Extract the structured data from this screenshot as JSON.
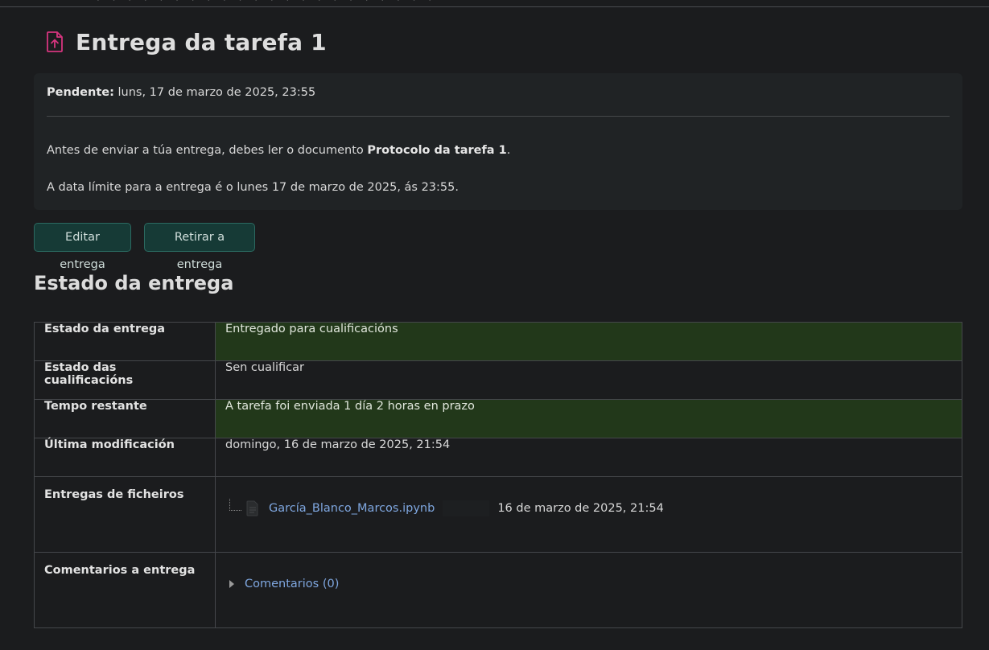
{
  "header": {
    "title": "Entrega da tarefa 1",
    "icon": "assignment-upload-icon",
    "icon_color": "#d6357f"
  },
  "info": {
    "due_label": "Pendente:",
    "due_value": "luns, 17 de marzo de 2025, 23:55",
    "para1_before": "Antes de enviar a túa entrega, debes ler o documento ",
    "para1_bold": "Protocolo da tarefa 1",
    "para1_after": ".",
    "para2": "A data límite para a entrega é o lunes 17 de marzo de 2025, ás 23:55."
  },
  "buttons": {
    "edit": "Editar entrega",
    "remove": "Retirar a entrega"
  },
  "section": {
    "title": "Estado da entrega"
  },
  "status_table": {
    "rows": [
      {
        "label": "Estado da entrega",
        "value": "Entregado para cualificacións",
        "status": "ok"
      },
      {
        "label": "Estado das cualificacións",
        "value": "Sen cualificar",
        "status": "neutral"
      },
      {
        "label": "Tempo restante",
        "value": "A tarefa foi enviada 1 día 2 horas en prazo",
        "status": "ok"
      },
      {
        "label": "Última modificación",
        "value": "domingo, 16 de marzo de 2025, 21:54",
        "status": "neutral"
      },
      {
        "label": "Entregas de ficheiros"
      },
      {
        "label": "Comentarios a entrega"
      }
    ],
    "file": {
      "name": "García_Blanco_Marcos.ipynb",
      "date": "16 de marzo de 2025, 21:54",
      "icon": "document-file-icon"
    },
    "comments": {
      "label": "Comentarios (0)"
    }
  },
  "colors": {
    "background": "#1b1c1e",
    "panel": "#202325",
    "button_bg": "#163a36",
    "status_ok_bg": "#22381a",
    "link": "#7fa7e0"
  }
}
